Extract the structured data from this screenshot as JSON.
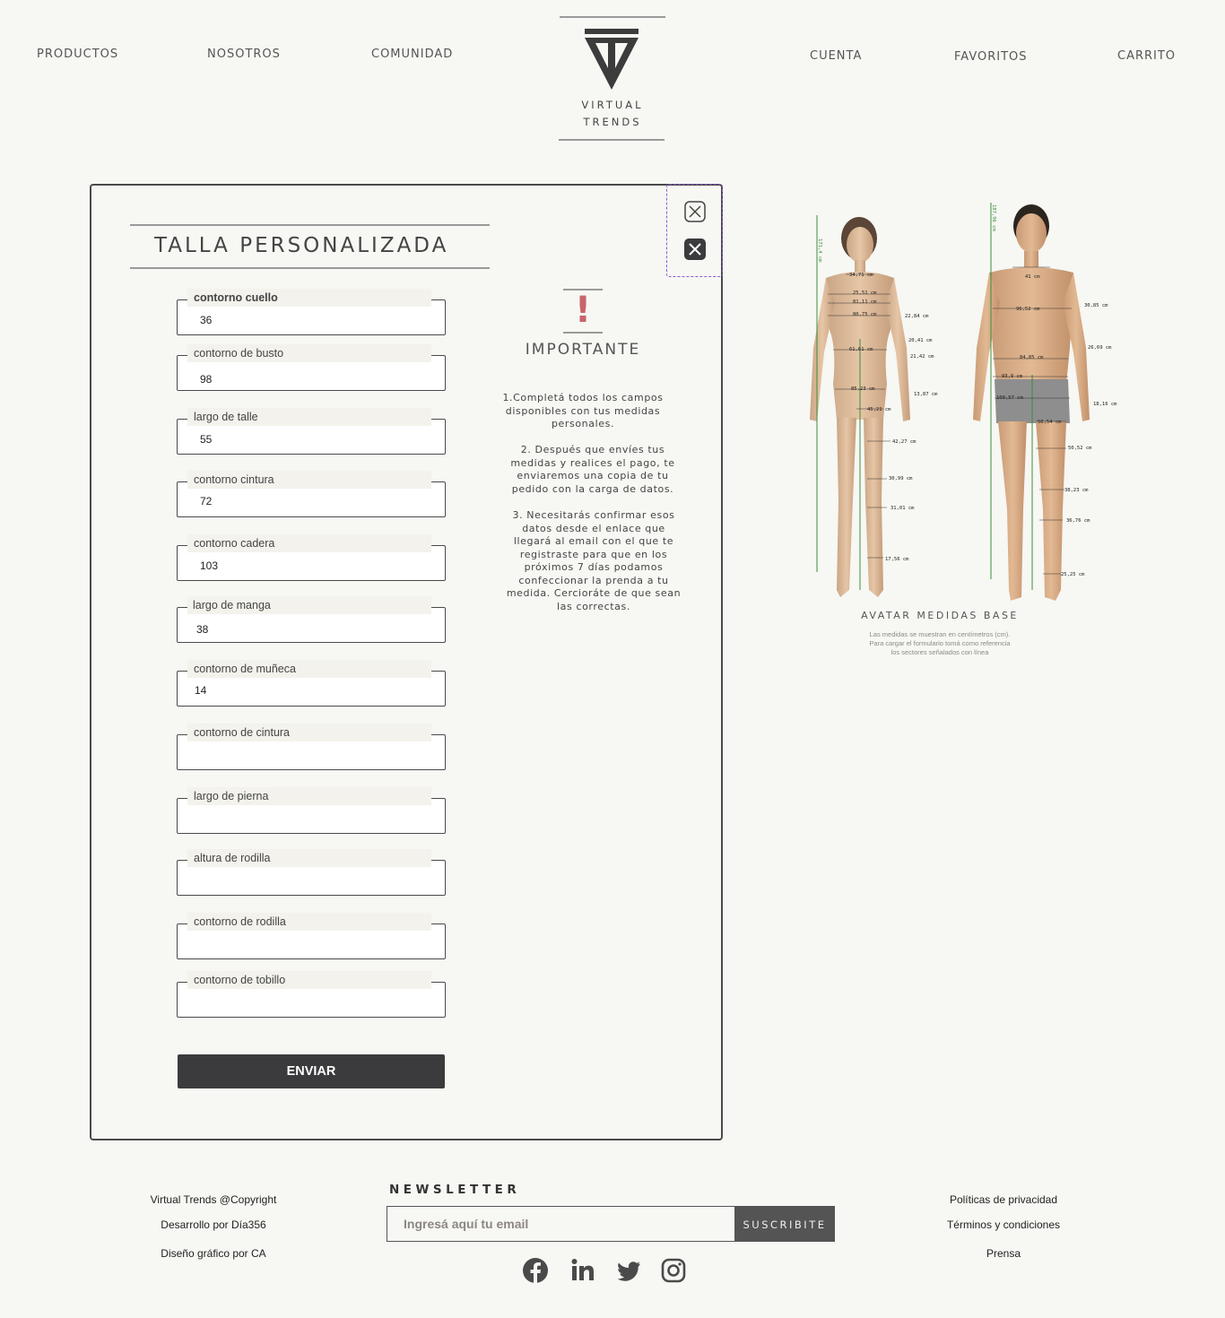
{
  "nav": {
    "left": [
      "PRODUCTOS",
      "NOSOTROS",
      "COMUNIDAD"
    ],
    "right": [
      "CUENTA",
      "FAVORITOS",
      "CARRITO"
    ]
  },
  "logo": {
    "line1": "VIRTUAL",
    "line2": "TRENDS"
  },
  "modal": {
    "title": "TALLA PERSONALIZADA",
    "fields": [
      {
        "label": "contorno cuello",
        "value": "36"
      },
      {
        "label": "contorno de busto",
        "value": "98"
      },
      {
        "label": "largo de talle",
        "value": "55"
      },
      {
        "label": "contorno cintura",
        "value": "72"
      },
      {
        "label": "contorno cadera",
        "value": "103"
      },
      {
        "label": "largo de manga",
        "value": "38"
      },
      {
        "label": "contorno de muñeca",
        "value": "14"
      },
      {
        "label": "contorno de cintura",
        "value": ""
      },
      {
        "label": "largo de pierna",
        "value": ""
      },
      {
        "label": "altura de rodilla",
        "value": ""
      },
      {
        "label": "contorno de rodilla",
        "value": ""
      },
      {
        "label": "contorno de tobillo",
        "value": ""
      }
    ],
    "submit_label": "ENVIAR",
    "important": {
      "mark": "!",
      "title": "IMPORTANTE",
      "p1": "1.Completá todos los campos disponibles con tus medidas personales.",
      "p2": "2. Después que envíes tus medidas y realices el pago, te enviaremos una copia de tu pedido con la carga de datos.",
      "p3": "3. Necesitarás confirmar esos datos desde el enlace que llegará al email con el que te registraste para que en los próximos 7 días podamos confeccionar la prenda a tu medida. Cercioráte de que sean las correctas."
    }
  },
  "avatar": {
    "title": "AVATAR MEDIDAS BASE",
    "note_line1": "Las medidas se muestran en centímetros (cm).",
    "note_line2": "Para cargar el formulario tomá como referencia",
    "note_line3": "los sectores señalados con línea",
    "female_labels": [
      "171,4 cm",
      "34,71 cm",
      "25,51 cm",
      "81,11 cm",
      "80,75 cm",
      "22,84 cm",
      "20,41 cm",
      "61,61 cm",
      "21,42 cm",
      "85,23 cm",
      "13,87 cm",
      "45,21 cm",
      "42,27 cm",
      "30,99 cm",
      "31,01 cm",
      "17,56 cm"
    ],
    "male_labels": [
      "187,96 cm",
      "41 cm",
      "96,52 cm",
      "30,85 cm",
      "26,69 cm",
      "84,85 cm",
      "93,9 cm",
      "100,57 cm",
      "18,16 cm",
      "56,54 cm",
      "50,52 cm",
      "38,23 cm",
      "36,76 cm",
      "25,25 cm"
    ]
  },
  "footer": {
    "left": [
      "Virtual Trends @Copyright",
      "Desarrollo por Día356",
      "Diseño gráfico por CA"
    ],
    "newsletter_title": "NEWSLETTER",
    "email_placeholder": "Ingresá aquí tu email",
    "subscribe_label": "SUSCRIBITE",
    "right": [
      "Políticas de privacidad",
      "Términos y condiciones",
      "Prensa"
    ]
  },
  "colors": {
    "background": "#f7f7f3",
    "accent_pink": "#c9656b",
    "dark": "#3b3b3d",
    "close_box_border": "#8a5cd6"
  }
}
